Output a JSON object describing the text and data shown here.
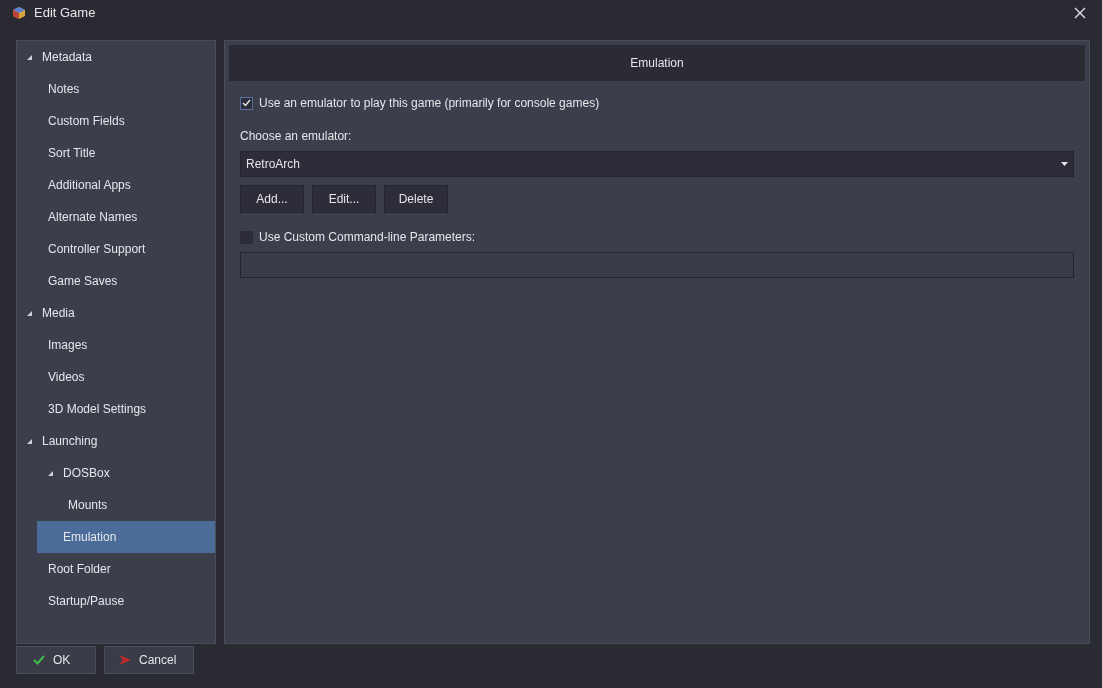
{
  "window": {
    "title": "Edit Game"
  },
  "sidebar": {
    "items": [
      {
        "label": "Metadata",
        "expanded": true,
        "selected": false,
        "children": [
          {
            "label": "Notes",
            "selected": false
          },
          {
            "label": "Custom Fields",
            "selected": false
          },
          {
            "label": "Sort Title",
            "selected": false
          },
          {
            "label": "Additional Apps",
            "selected": false
          },
          {
            "label": "Alternate Names",
            "selected": false
          },
          {
            "label": "Controller Support",
            "selected": false
          },
          {
            "label": "Game Saves",
            "selected": false
          }
        ]
      },
      {
        "label": "Media",
        "expanded": true,
        "selected": false,
        "children": [
          {
            "label": "Images",
            "selected": false
          },
          {
            "label": "Videos",
            "selected": false
          },
          {
            "label": "3D Model Settings",
            "selected": false
          }
        ]
      },
      {
        "label": "Launching",
        "expanded": true,
        "selected": false,
        "children": [
          {
            "label": "DOSBox",
            "expanded": true,
            "selected": false,
            "children": [
              {
                "label": "Mounts",
                "selected": false
              }
            ]
          },
          {
            "label": "Emulation",
            "selected": true
          },
          {
            "label": "Root Folder",
            "selected": false
          },
          {
            "label": "Startup/Pause",
            "selected": false
          }
        ]
      }
    ]
  },
  "panel": {
    "header": "Emulation",
    "use_emulator": {
      "label": "Use an emulator to play this game (primarily for console games)",
      "checked": true
    },
    "emulator_label": "Choose an emulator:",
    "emulator": {
      "value": "RetroArch"
    },
    "buttons": [
      "Add...",
      "Edit...",
      "Delete"
    ],
    "custom_params": {
      "label": "Use Custom Command-line Parameters:",
      "checked": false
    }
  },
  "footer": {
    "ok": "OK",
    "cancel": "Cancel"
  }
}
